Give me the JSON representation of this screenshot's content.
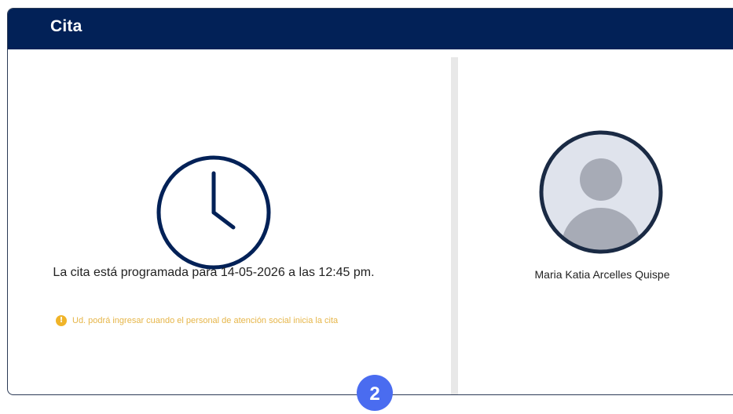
{
  "header": {
    "title": "Cita"
  },
  "left_panel": {
    "icon": "clock-icon",
    "schedule_text": "La cita está programada para 14-05-2026 a las 12:45 pm.",
    "notice": {
      "icon": "info-icon",
      "icon_glyph": "!",
      "text": "Ud. podrá ingresar cuando el personal de atención social inicia la cita",
      "color": "#e6b64a"
    }
  },
  "right_panel": {
    "avatar_icon": "user-avatar-icon",
    "patient_name": "Maria Katia Arcelles Quispe"
  },
  "step_badge": {
    "value": "2"
  },
  "colors": {
    "header_bg": "#022157",
    "accent_badge": "#4a6cf0",
    "warning": "#f0b429",
    "divider": "#e8e8e8"
  }
}
